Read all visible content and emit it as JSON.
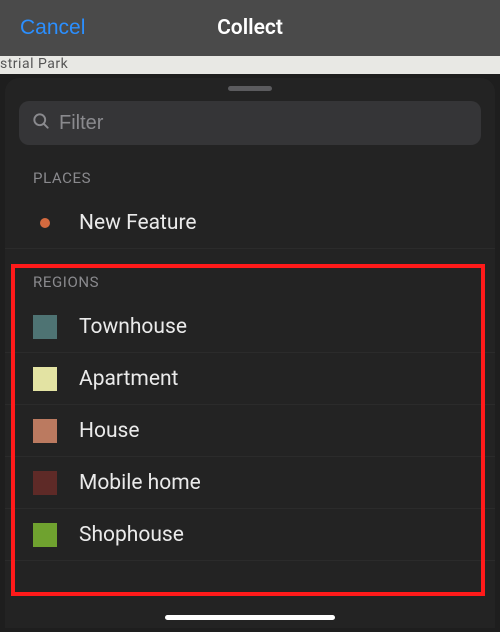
{
  "titlebar": {
    "cancel": "Cancel",
    "title": "Collect"
  },
  "map_behind_text": "strial Park",
  "filter": {
    "placeholder": "Filter",
    "value": ""
  },
  "sections": {
    "places": {
      "label": "PLACES",
      "items": [
        {
          "label": "New Feature",
          "color": "#d46a3f"
        }
      ]
    },
    "regions": {
      "label": "REGIONS",
      "items": [
        {
          "label": "Townhouse",
          "color": "#4e7373"
        },
        {
          "label": "Apartment",
          "color": "#e3e3a3"
        },
        {
          "label": "House",
          "color": "#bb7a60"
        },
        {
          "label": "Mobile home",
          "color": "#5e2a27"
        },
        {
          "label": "Shophouse",
          "color": "#6fa22f"
        }
      ]
    }
  }
}
